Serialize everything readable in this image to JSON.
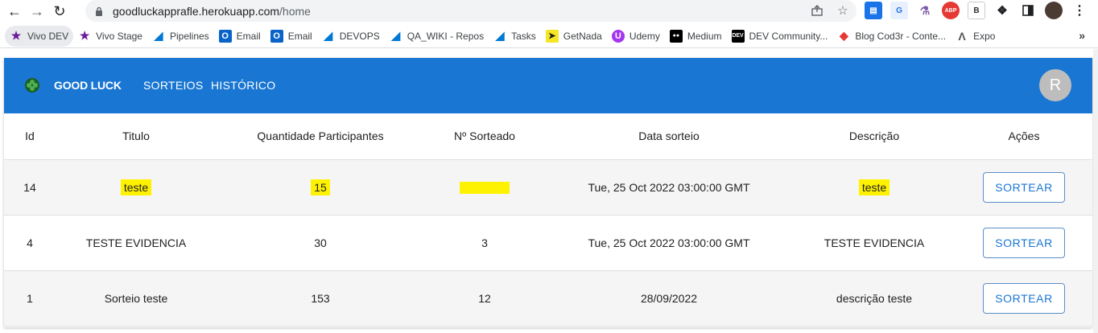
{
  "browser": {
    "url_host": "goodluckapprafle.herokuapp.com",
    "url_path": "/home",
    "bookmarks": [
      {
        "label": "Vivo DEV",
        "icon": "vivo-icon",
        "color": "#6a1b9a"
      },
      {
        "label": "Vivo Stage",
        "icon": "vivo-icon",
        "color": "#6a1b9a"
      },
      {
        "label": "Pipelines",
        "icon": "azure-devops-icon",
        "color": "#0078d4"
      },
      {
        "label": "Email",
        "icon": "outlook-icon",
        "color": "#0a64c8"
      },
      {
        "label": "Email",
        "icon": "outlook-icon",
        "color": "#0a64c8"
      },
      {
        "label": "DEVOPS",
        "icon": "azure-devops-icon",
        "color": "#0078d4"
      },
      {
        "label": "QA_WIKI - Repos",
        "icon": "azure-devops-icon",
        "color": "#0078d4"
      },
      {
        "label": "Tasks",
        "icon": "azure-devops-icon",
        "color": "#0078d4"
      },
      {
        "label": "GetNada",
        "icon": "getnada-icon",
        "color": "#f5e626"
      },
      {
        "label": "Udemy",
        "icon": "udemy-icon",
        "color": "#a435f0"
      },
      {
        "label": "Medium",
        "icon": "medium-icon",
        "color": "#000000"
      },
      {
        "label": "DEV Community...",
        "icon": "dev-icon",
        "color": "#000000"
      },
      {
        "label": "Blog Cod3r - Conte...",
        "icon": "cod3r-icon",
        "color": "#e53935"
      },
      {
        "label": "Expo",
        "icon": "expo-icon",
        "color": "#555555"
      }
    ],
    "more": "»"
  },
  "app": {
    "brand": "GOOD LUCK",
    "nav": [
      "SORTEIOS",
      "HISTÓRICO"
    ],
    "user_initial": "R",
    "colors": {
      "appbar": "#1976d2",
      "highlight": "#fff200"
    }
  },
  "table": {
    "headers": [
      "Id",
      "Titulo",
      "Quantidade Participantes",
      "Nº Sorteado",
      "Data sorteio",
      "Descrição",
      "Ações"
    ],
    "rows": [
      {
        "id": "14",
        "titulo": "teste",
        "qtd": "15",
        "sorteado": "",
        "data": "Tue, 25 Oct 2022 03:00:00 GMT",
        "descricao": "teste",
        "acao": "SORTEAR"
      },
      {
        "id": "4",
        "titulo": "TESTE EVIDENCIA",
        "qtd": "30",
        "sorteado": "3",
        "data": "Tue, 25 Oct 2022 03:00:00 GMT",
        "descricao": "TESTE EVIDENCIA",
        "acao": "SORTEAR"
      },
      {
        "id": "1",
        "titulo": "Sorteio teste",
        "qtd": "153",
        "sorteado": "12",
        "data": "28/09/2022",
        "descricao": "descrição teste",
        "acao": "SORTEAR"
      }
    ]
  }
}
